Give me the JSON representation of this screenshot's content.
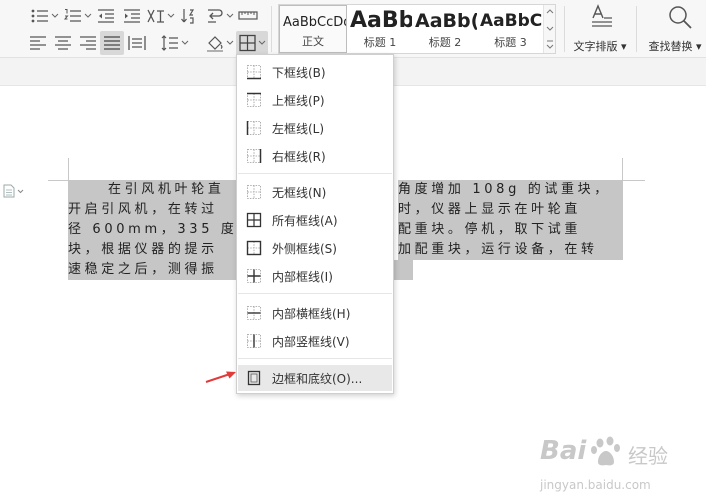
{
  "colors": {
    "selection": "#c6c6c6",
    "menu_hover": "#e8e8e8",
    "arrow": "#e03a3a",
    "icon_stroke": "#555555"
  },
  "styles_gallery": {
    "items": [
      {
        "sample": "AaBbCcDd",
        "label": "正文"
      },
      {
        "sample": "AaBb",
        "label": "标题 1"
      },
      {
        "sample": "AaBb(",
        "label": "标题 2"
      },
      {
        "sample": "AaBbC(",
        "label": "标题 3"
      }
    ]
  },
  "toolbar": {
    "text_layout_label": "文字排版",
    "find_replace_label": "查找替换",
    "text_layout_icon": "text-layout-icon",
    "find_replace_icon": "magnifier-icon"
  },
  "border_menu": {
    "items": [
      {
        "label": "下框线(B)",
        "icon": "border-bottom-icon"
      },
      {
        "label": "上框线(P)",
        "icon": "border-top-icon"
      },
      {
        "label": "左框线(L)",
        "icon": "border-left-icon"
      },
      {
        "label": "右框线(R)",
        "icon": "border-right-icon"
      },
      {
        "label": "无框线(N)",
        "icon": "border-none-icon"
      },
      {
        "label": "所有框线(A)",
        "icon": "border-all-icon"
      },
      {
        "label": "外侧框线(S)",
        "icon": "border-outside-icon"
      },
      {
        "label": "内部框线(I)",
        "icon": "border-inside-icon"
      },
      {
        "label": "内部横框线(H)",
        "icon": "border-inside-horizontal-icon"
      },
      {
        "label": "内部竖框线(V)",
        "icon": "border-inside-vertical-icon"
      },
      {
        "label": "边框和底纹(O)...",
        "icon": "borders-and-shading-icon"
      }
    ]
  },
  "document": {
    "lines": [
      {
        "left": "在引风机叶轮直",
        "right": "角度增加 108g 的试重块，"
      },
      {
        "left": "开启引风机，在转过",
        "right": "时，仪器上显示在叶轮直"
      },
      {
        "left": "径 600mm，335 度的",
        "right": "配重块。停机，取下试重"
      },
      {
        "left": "块，根据仪器的提示",
        "right": "加配重块，运行设备，在转"
      },
      {
        "left": "速稳定之后，测得振",
        "right": ""
      }
    ]
  },
  "watermark": {
    "brand": "Bai",
    "brand_suffix": "经验",
    "url": "jingyan.baidu.com"
  }
}
